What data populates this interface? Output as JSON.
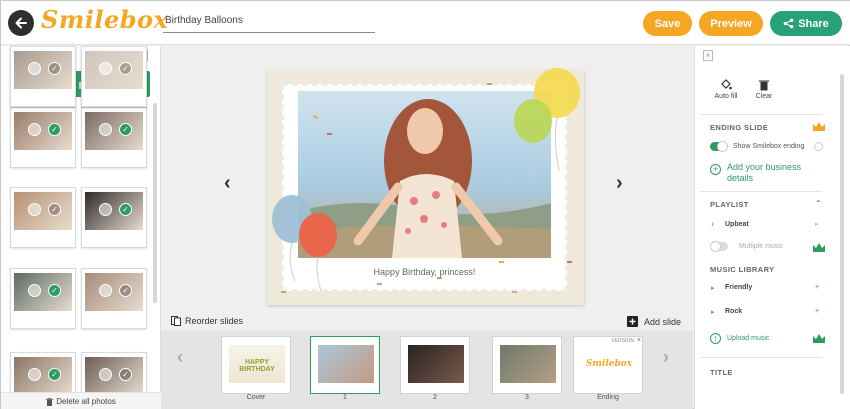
{
  "header": {
    "logo": "Smilebox",
    "title_value": "Birthday Balloons",
    "save_label": "Save",
    "preview_label": "Preview",
    "share_label": "Share"
  },
  "colors": {
    "orange": "#f5a623",
    "green": "#2d9c62",
    "share_green": "#28a07a"
  },
  "left_panel": {
    "add_photos_label": "+ Add photos",
    "delete_all_label": "Delete all photos",
    "photos_selected": [
      true,
      true,
      false,
      true,
      true,
      false,
      true,
      false,
      true,
      true,
      false,
      false
    ]
  },
  "canvas": {
    "caption": "Happy Birthday, princess!",
    "reorder_label": "Reorder slides",
    "add_slide_label": "Add slide"
  },
  "filmstrip": {
    "slides": [
      {
        "label": "Cover",
        "thumb_text": "HAPPY BIRTHDAY"
      },
      {
        "label": "1"
      },
      {
        "label": "2"
      },
      {
        "label": "3"
      },
      {
        "label": "Ending",
        "thumb_text": "Smilebox",
        "badge": "VERSION"
      }
    ]
  },
  "right_panel": {
    "auto_fill_label": "Auto fill",
    "clear_label": "Clear",
    "ending_slide_header": "ENDING SLIDE",
    "show_ending_label": "Show Smilebox ending",
    "add_business_label": "Add your business details",
    "playlist_header": "PLAYLIST",
    "upbeat_label": "Upbeat",
    "multiple_music_label": "Multiple music",
    "music_library_header": "MUSIC LIBRARY",
    "friendly_label": "Friendly",
    "rock_label": "Rock",
    "upload_music_label": "Upload music",
    "title_header": "TITLE"
  }
}
